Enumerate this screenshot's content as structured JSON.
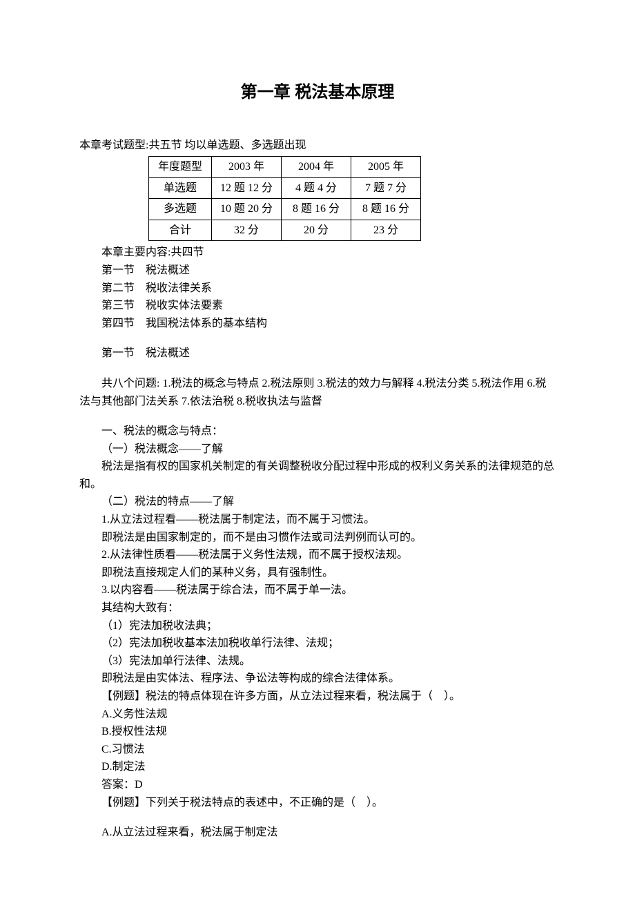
{
  "title": "第一章 税法基本原理",
  "intro": "本章考试题型:共五节 均以单选题、多选题出现",
  "table": {
    "headers": [
      "年度题型",
      "2003 年",
      "2004 年",
      "2005 年"
    ],
    "rows": [
      [
        "单选题",
        "12 题 12 分",
        "4 题 4 分",
        "7 题 7 分"
      ],
      [
        "多选题",
        "10 题 20 分",
        "8 题 16 分",
        "8 题 16 分"
      ],
      [
        "合计",
        "32 分",
        "20 分",
        "23 分"
      ]
    ]
  },
  "outline": {
    "lead": "本章主要内容:共四节",
    "items": [
      "第一节　税法概述",
      "第二节　税收法律关系",
      "第三节　税收实体法要素",
      "第四节　我国税法体系的基本结构"
    ]
  },
  "section1_title": "第一节　税法概述",
  "section1_topics": "共八个问题: 1.税法的概念与特点 2.税法原则 3.税法的效力与解释 4.税法分类 5.税法作用 6.税法与其他部门法关系 7.依法治税 8.税收执法与监督",
  "content": {
    "p1": "一、税法的概念与特点：",
    "p2": "（一）税法概念——了解",
    "p3": "税法是指有权的国家机关制定的有关调整税收分配过程中形成的权利义务关系的法律规范的总和。",
    "p4": "（二）税法的特点——了解",
    "p5": "1.从立法过程看——税法属于制定法，而不属于习惯法。",
    "p6": "即税法是由国家制定的，而不是由习惯作法或司法判例而认可的。",
    "p7": "2.从法律性质看——税法属于义务性法规，而不属于授权法规。",
    "p8": "即税法直接规定人们的某种义务，具有强制性。",
    "p9": "3.以内容看——税法属于综合法，而不属于单一法。",
    "p10": "其结构大致有：",
    "p11": "（1）宪法加税收法典；",
    "p12": "（2）宪法加税收基本法加税收单行法律、法规；",
    "p13": "（3）宪法加单行法律、法规。",
    "p14": "即税法是由实体法、程序法、争讼法等构成的综合法律体系。"
  },
  "q1": {
    "stem": "【例题】税法的特点体现在许多方面，从立法过程来看，税法属于（　）。",
    "a": "A.义务性法规",
    "b": "B.授权性法规",
    "c": "C.习惯法",
    "d": "D.制定法",
    "ans": "答案：D"
  },
  "q2": {
    "stem": "【例题】下列关于税法特点的表述中，不正确的是（　）。",
    "a": "A.从立法过程来看，税法属于制定法"
  }
}
